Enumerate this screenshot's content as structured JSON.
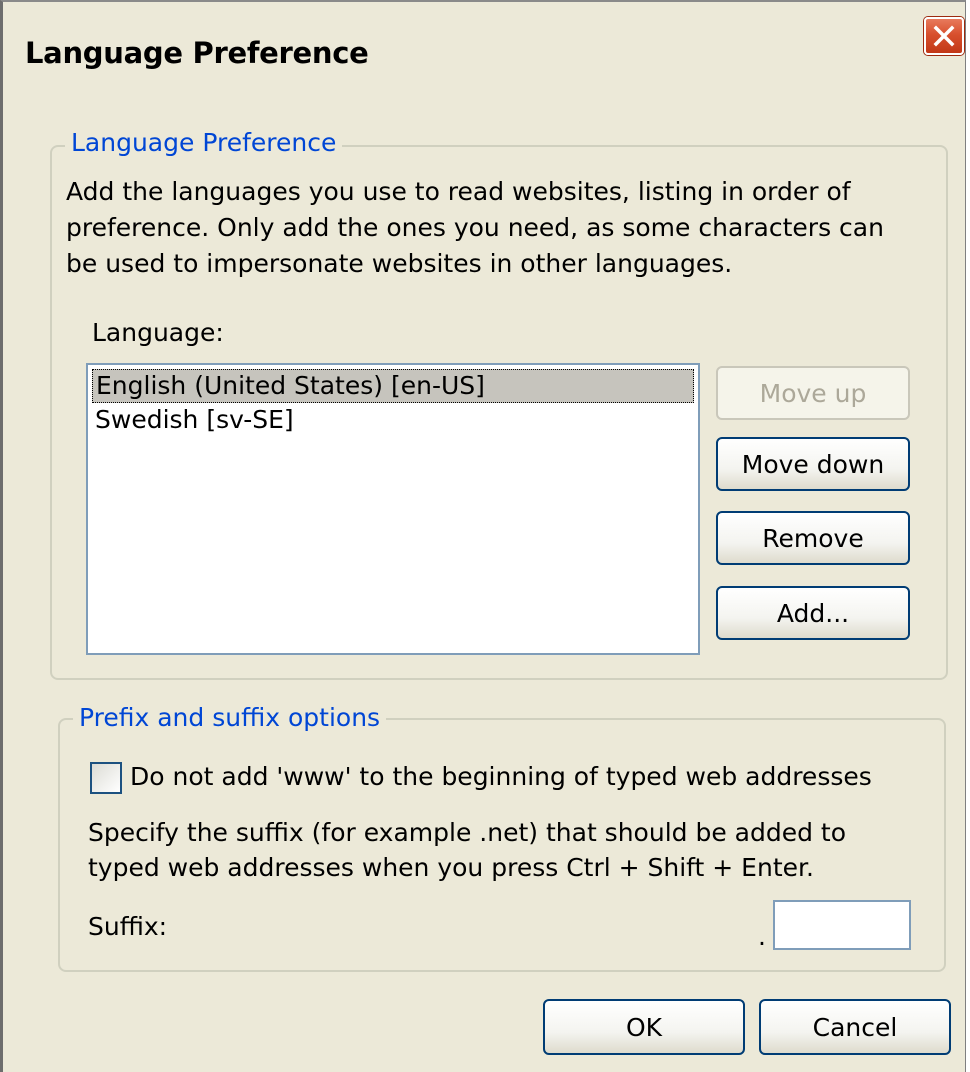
{
  "window": {
    "title": "Language Preference"
  },
  "language_group": {
    "legend": "Language Preference",
    "description_lines": [
      "Add the languages you use to read websites, listing in order of",
      "preference. Only add the ones you need, as some characters can",
      "be used to impersonate websites in other languages."
    ],
    "list_label": "Language:",
    "languages": [
      {
        "label": "English (United States) [en-US]",
        "selected": true
      },
      {
        "label": "Swedish [sv-SE]",
        "selected": false
      }
    ],
    "buttons": {
      "move_up": "Move up",
      "move_down": "Move down",
      "remove": "Remove",
      "add": "Add..."
    }
  },
  "prefix_group": {
    "legend": "Prefix and suffix options",
    "checkbox_label": "Do not add 'www' to the beginning of typed web addresses",
    "checkbox_checked": false,
    "suffix_description_lines": [
      "Specify the suffix (for example .net) that should be added to",
      "typed web addresses when you press Ctrl + Shift + Enter."
    ],
    "suffix_label": "Suffix:",
    "suffix_dot": ".",
    "suffix_value": ""
  },
  "footer": {
    "ok": "OK",
    "cancel": "Cancel"
  },
  "colors": {
    "dialog_bg": "#ece9d8",
    "legend_text": "#0046d5",
    "close_button": "#d8502e",
    "selection_bg": "#c6c4bd"
  },
  "icons": {
    "close": "close-x-icon"
  }
}
